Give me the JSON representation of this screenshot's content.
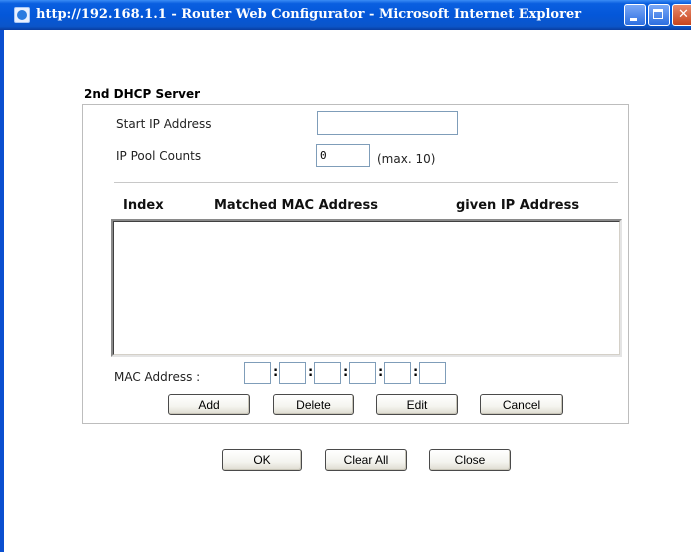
{
  "window": {
    "title": "http://192.168.1.1 - Router Web Configurator - Microsoft Internet Explorer"
  },
  "section": {
    "title": "2nd DHCP Server"
  },
  "fields": {
    "start_ip_label": "Start IP Address",
    "start_ip_value": "",
    "pool_counts_label": "IP Pool Counts",
    "pool_counts_value": "0",
    "pool_counts_hint": "(max. 10)"
  },
  "table": {
    "columns": [
      "Index",
      "Matched MAC Address",
      "given IP Address"
    ],
    "rows": []
  },
  "mac": {
    "label": "MAC Address :",
    "octets": [
      "",
      "",
      "",
      "",
      "",
      ""
    ],
    "separator": ":"
  },
  "row_buttons": {
    "add": "Add",
    "delete": "Delete",
    "edit": "Edit",
    "cancel": "Cancel"
  },
  "footer_buttons": {
    "ok": "OK",
    "clear_all": "Clear All",
    "close": "Close"
  }
}
